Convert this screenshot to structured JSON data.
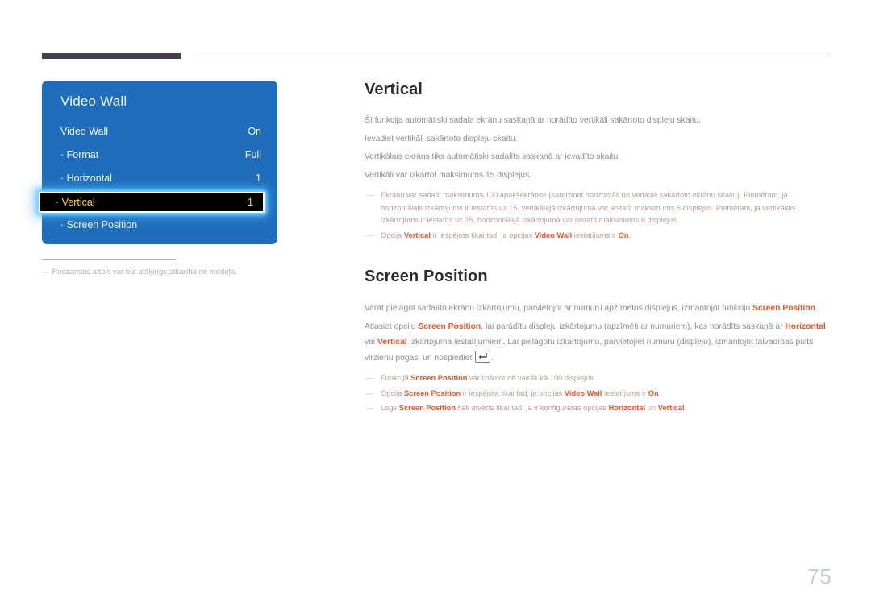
{
  "header": {
    "accent_bar": "",
    "rule": ""
  },
  "osd": {
    "title": "Video Wall",
    "rows": [
      {
        "label": "Video Wall",
        "value": "On",
        "sub": false,
        "selected": false
      },
      {
        "label": "· Format",
        "value": "Full",
        "sub": true,
        "selected": false
      },
      {
        "label": "· Horizontal",
        "value": "1",
        "sub": true,
        "selected": false
      },
      {
        "label": "· Vertical",
        "value": "1",
        "sub": true,
        "selected": true
      },
      {
        "label": "· Screen Position",
        "value": "",
        "sub": true,
        "selected": false
      }
    ],
    "caption_dash": "―",
    "caption": "Redzamais attēls var būt atšķirīgs atkarībā no modeļa."
  },
  "article": {
    "vertical": {
      "title": "Vertical",
      "paragraphs": [
        "Šī funkcija automātiski sadala ekrānu saskaņā ar norādīto vertikāli sakārtoto displeju skaitu.",
        "Ievadiet vertikāli sakārtoto displeju skaitu.",
        "Vertikālais ekrāns tiks automātiski sadalīts saskaņā ar ievadīto skaitu.",
        "Vertikāli var izkārtot maksimums 15 displejus."
      ],
      "note1": "Ekrānu var sadalīt maksimums 100 apakšekrānos (sareizinot horizontāli un vertikāli sakārtoto ekrānu skaitu). Piemēram, ja horizontālais izkārtojums ir iestatīts uz 15, vertikālajā izkārtojumā var iestatīt maksimums 6 displejus. Piemēram, ja vertikālais izkārtojums ir iestatīts uz 15, horizontālajā izkārtojumā var iestatīt maksimums 6 displejus.",
      "note2": {
        "a": "Opcija ",
        "b": "Vertical",
        "c": " ir iespējota tikai tad, ja opcijas ",
        "d": "Video Wall",
        "e": " iestatījums ir ",
        "f": "On",
        "g": "."
      }
    },
    "screen_position": {
      "title": "Screen Position",
      "p1": {
        "a": "Varat pielāgot sadalīto ekrānu izkārtojumu, pārvietojot ar numuru apzīmētos displejus, izmantojot funkciju ",
        "b": "Screen Position",
        "c": "."
      },
      "p2": {
        "a": "Atlasiet opciju ",
        "b": "Screen Position",
        "c": ", lai parādītu displeju izkārtojumu (apzīmēti ar numuriem), kas norādīts saskaņā ar ",
        "d": "Horizontal",
        "e": " vai ",
        "f": "Vertical",
        "g": " izkārtojuma iestatījumiem. Lai pielāgotu izkārtojumu, pārvietojiet numuru (displeju), izmantojot tālvadības pults virzienu pogas, un nospiediet ",
        "h": "."
      },
      "note1": {
        "a": "Funkcijā ",
        "b": "Screen Position",
        "c": " var izvietot ne vairāk kā 100 displejus."
      },
      "note2": {
        "a": "Opcija ",
        "b": "Screen Position",
        "c": " ir iespējota tikai tad, ja opcijas ",
        "d": "Video Wall",
        "e": " iestatījums ir ",
        "f": "On",
        "g": "."
      },
      "note3": {
        "a": "Logs ",
        "b": "Screen Position",
        "c": " tiek atvērts tikai tad, ja ir konfigurētas opcijas ",
        "d": "Horizontal",
        "e": " un ",
        "f": "Vertical",
        "g": "."
      }
    }
  },
  "note_dash": "―",
  "page_number": "75",
  "colors": {
    "osd_blue": "#1f6cba",
    "accent_orange": "#e4562c",
    "header_purple": "#463c55",
    "highlight_text": "#ffd24a",
    "page_number": "#c6cdd2"
  }
}
